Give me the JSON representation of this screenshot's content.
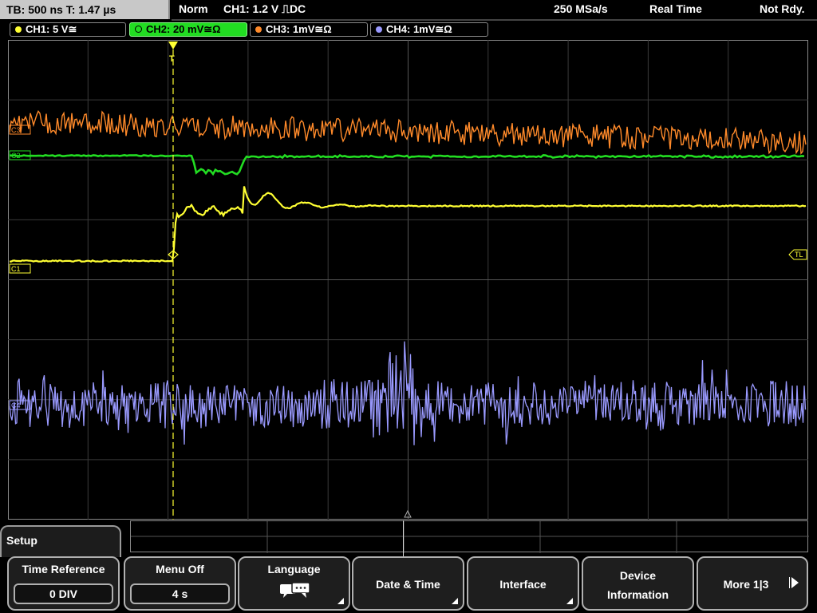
{
  "status": {
    "timebase": "TB: 500 ns   T: 1.47 µs",
    "mode": "Norm",
    "trigger": "CH1: 1.2 V ⎍DC",
    "sample_rate": "250 MSa/s",
    "acq_mode": "Real Time",
    "state": "Not Rdy."
  },
  "channels": [
    {
      "label": "CH1: 5 V≅",
      "color": "#ffff33",
      "active": false
    },
    {
      "label": "CH2: 20 mV≅Ω",
      "color": "#22dd22",
      "active": true
    },
    {
      "label": "CH3: 1mV≅Ω",
      "color": "#ff8a2a",
      "active": false
    },
    {
      "label": "CH4: 1mV≅Ω",
      "color": "#9a9aff",
      "active": false
    }
  ],
  "markers": {
    "c1": "C1",
    "c2": "C2",
    "c3": "C3",
    "c4": "C4",
    "trigger_level": "TL",
    "trigger_pos": "T"
  },
  "setup": {
    "title": "Setup"
  },
  "softkeys": {
    "time_reference": {
      "title": "Time Reference",
      "value": "0 DIV"
    },
    "menu_off": {
      "title": "Menu Off",
      "value": "4 s"
    },
    "language": {
      "title": "Language",
      "icon": "speech-bubbles-icon"
    },
    "date_time": {
      "title": "Date & Time"
    },
    "interface": {
      "title": "Interface"
    },
    "device_info": {
      "line1": "Device",
      "line2": "Information"
    },
    "more": {
      "title": "More 1|3"
    }
  }
}
